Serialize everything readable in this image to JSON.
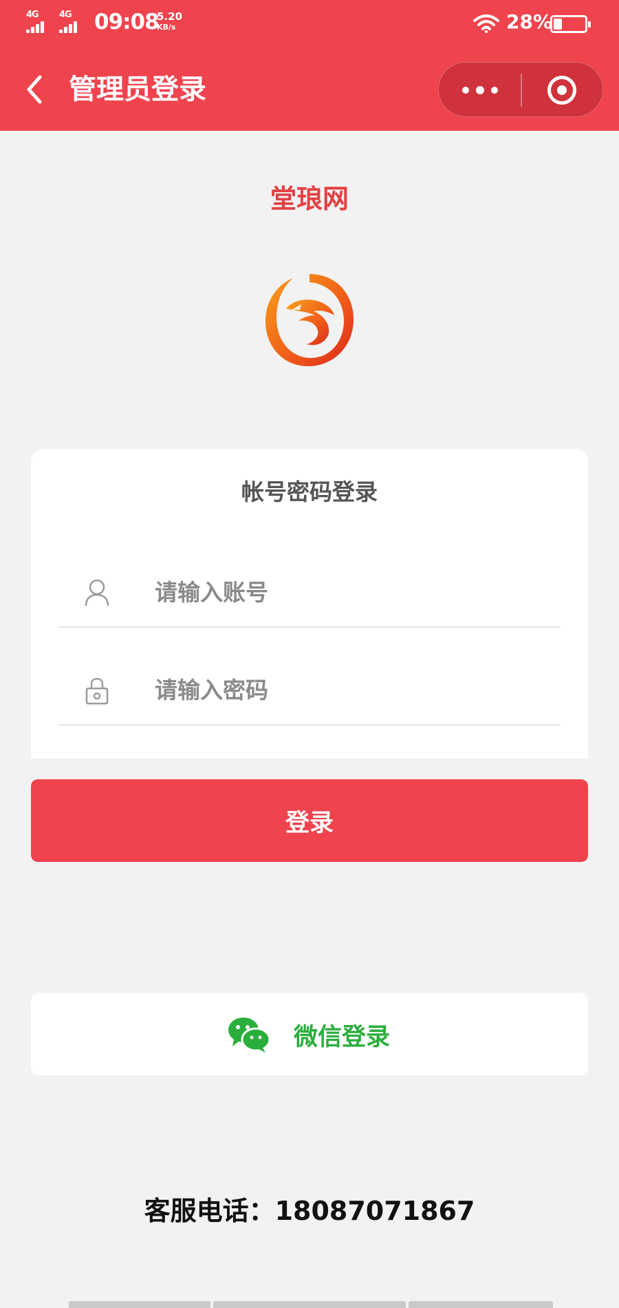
{
  "status_bar": {
    "network_1": "4G",
    "network_2": "4G",
    "time": "09:08",
    "speed_value": "5.20",
    "speed_unit": "KB/s",
    "battery_percent": "28%",
    "battery_level": 0.28
  },
  "nav": {
    "title": "管理员登录",
    "back_icon": "chevron-left-icon",
    "more_icon": "more-dots-icon",
    "close_icon": "target-close-icon"
  },
  "brand": {
    "site_name": "堂琅网",
    "logo_icon": "dragon-logo-icon"
  },
  "login_card": {
    "title": "帐号密码登录",
    "account": {
      "placeholder": "请输入账号",
      "value": "",
      "icon": "user-icon"
    },
    "password": {
      "placeholder": "请输入密码",
      "value": "",
      "icon": "lock-icon"
    }
  },
  "login_button": {
    "label": "登录"
  },
  "wechat": {
    "label": "微信登录",
    "icon": "wechat-icon"
  },
  "service": {
    "label": "客服电话：",
    "phone": "18087071867"
  },
  "colors": {
    "brand_red": "#ef434d",
    "wechat_green": "#2aae3c",
    "page_bg": "#f2f2f2"
  }
}
